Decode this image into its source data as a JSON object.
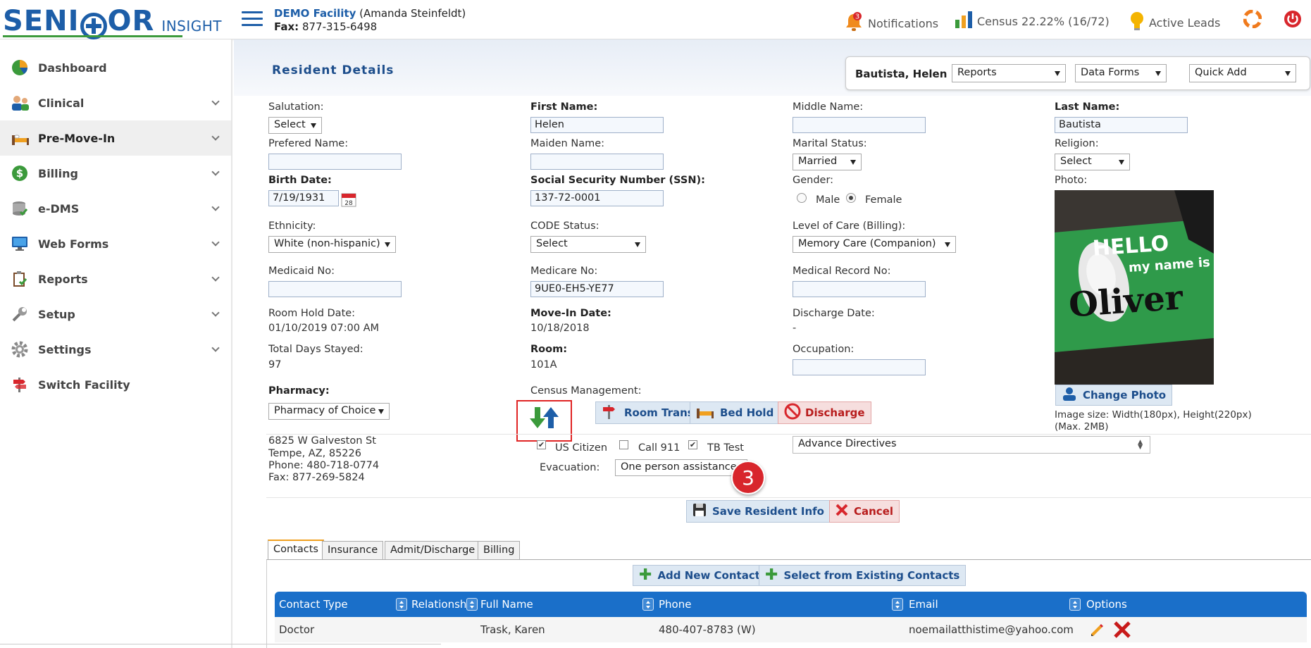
{
  "header": {
    "logo_big_1": "SEN",
    "logo_big_2": "OR",
    "logo_small": "INSIGHT",
    "facility_name": "DEMO Facility",
    "facility_user": " (Amanda Steinfeldt)",
    "fax_label": "Fax:",
    "fax_value": " 877-315-6498",
    "notifications_count": "3",
    "notifications_label": "Notifications",
    "census_label": "Census 22.22% (16/72)",
    "leads_label": "Active Leads"
  },
  "sidebar": {
    "items": [
      {
        "label": "Dashboard"
      },
      {
        "label": "Clinical"
      },
      {
        "label": "Pre-Move-In"
      },
      {
        "label": "Billing"
      },
      {
        "label": "e-DMS"
      },
      {
        "label": "Web Forms"
      },
      {
        "label": "Reports"
      },
      {
        "label": "Setup"
      },
      {
        "label": "Settings"
      },
      {
        "label": "Switch Facility"
      }
    ]
  },
  "page": {
    "title": "Resident Details",
    "resident_name": "Bautista, Helen",
    "reports_select": "Reports",
    "dataforms_select": "Data Forms",
    "quickadd_select": "Quick Add"
  },
  "form": {
    "salutation_label": "Salutation:",
    "salutation_value": "Select",
    "first_name_label": "First Name:",
    "first_name_value": "Helen",
    "middle_name_label": "Middle Name:",
    "middle_name_value": "",
    "last_name_label": "Last Name:",
    "last_name_value": "Bautista",
    "preferred_label": "Prefered Name:",
    "preferred_value": "",
    "maiden_label": "Maiden Name:",
    "maiden_value": "",
    "marital_label": "Marital Status:",
    "marital_value": "Married",
    "religion_label": "Religion:",
    "religion_value": "Select",
    "birth_label": "Birth Date:",
    "birth_value": "7/19/1931",
    "ssn_label": "Social Security Number (SSN):",
    "ssn_value": "137-72-0001",
    "gender_label": "Gender:",
    "gender_male": "Male",
    "gender_female": "Female",
    "photo_label": "Photo:",
    "ethnicity_label": "Ethnicity:",
    "ethnicity_value": "White (non-hispanic)",
    "code_label": "CODE Status:",
    "code_value": "Select",
    "loc_label": "Level of Care (Billing):",
    "loc_value": "Memory Care (Companion)",
    "medicaid_label": "Medicaid No:",
    "medicaid_value": "",
    "medicare_label": "Medicare No:",
    "medicare_value": "9UE0-EH5-YE77",
    "mrn_label": "Medical Record No:",
    "mrn_value": "",
    "roomhold_label": "Room Hold Date:",
    "roomhold_value": "01/10/2019 07:00 AM",
    "movein_label": "Move-In Date:",
    "movein_value": "10/18/2018",
    "discharge_label": "Discharge Date:",
    "discharge_value": "-",
    "totaldays_label": "Total Days Stayed:",
    "totaldays_value": "97",
    "room_label": "Room:",
    "room_value": "101A",
    "occupation_label": "Occupation:",
    "occupation_value": "",
    "pharmacy_label": "Pharmacy:",
    "pharmacy_value": "Pharmacy of Choice",
    "census_mgmt_label": "Census Management:",
    "room_transfer_btn": "Room Transfer",
    "bed_hold_btn": "Bed Hold",
    "discharge_btn": "Discharge",
    "change_photo_btn": "Change Photo",
    "image_size_1": "Image size: Width(180px), Height(220px)",
    "image_size_2": "(Max. 2MB)",
    "photo_text_1": "HELLO",
    "photo_text_2": "my name is",
    "photo_text_3": "Oliver",
    "pharmacy_addr1": "6825 W Galveston St",
    "pharmacy_addr2": "Tempe, AZ, 85226",
    "pharmacy_phone": "Phone: 480-718-0774",
    "pharmacy_fax": "Fax: 877-269-5824",
    "us_citizen": "US Citizen",
    "call911": "Call 911",
    "tb_test": "TB Test",
    "evacuation_label": "Evacuation:",
    "evacuation_value": "One person assistance",
    "advance_directives": "Advance Directives",
    "save_btn": "Save Resident Info",
    "cancel_btn": "Cancel",
    "step_badge": "3"
  },
  "tabs": [
    {
      "label": "Contacts"
    },
    {
      "label": "Insurance"
    },
    {
      "label": "Admit/Discharge"
    },
    {
      "label": "Billing"
    }
  ],
  "contacts": {
    "add_new_btn": "Add New Contact",
    "select_existing_btn": "Select from Existing Contacts",
    "columns": [
      "Contact Type",
      "Relationship",
      "Full Name",
      "Phone",
      "Email",
      "Options"
    ],
    "rows": [
      {
        "type": "Doctor",
        "relationship": "",
        "name": "Trask, Karen",
        "phone": "480-407-8783 (W)",
        "email": "noemailatthistime@yahoo.com"
      }
    ]
  },
  "colors": {
    "brand_blue": "#1d5ea8",
    "header_blue": "#1a6fc9",
    "danger_red": "#d8262c"
  }
}
